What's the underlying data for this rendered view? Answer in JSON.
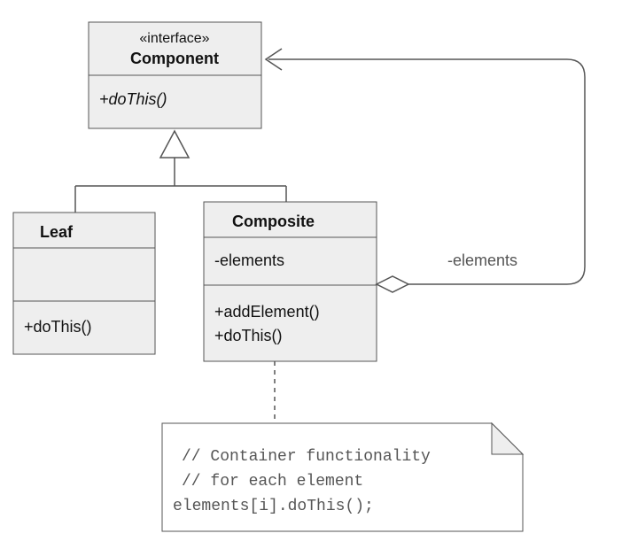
{
  "interface": {
    "stereotype": "«interface»",
    "name": "Component",
    "methods": [
      "+doThis()"
    ]
  },
  "leaf": {
    "name": "Leaf",
    "methods": [
      "+doThis()"
    ]
  },
  "composite": {
    "name": "Composite",
    "attributes": [
      "-elements"
    ],
    "methods": [
      "+addElement()",
      "+doThis()"
    ]
  },
  "aggregation": {
    "label": "-elements"
  },
  "note": {
    "lines": [
      "// Container functionality",
      "// for each element",
      "elements[i].doThis();"
    ]
  }
}
